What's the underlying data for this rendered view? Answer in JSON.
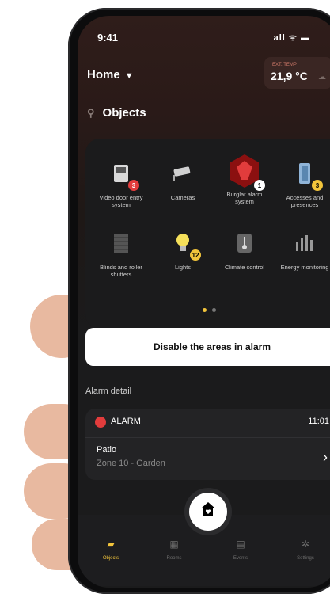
{
  "status": {
    "time": "9:41",
    "icons": "all ᯤ ▬"
  },
  "header": {
    "home_label": "Home",
    "temp_label": "EXT. TEMP",
    "temp_value": "21,9 °C"
  },
  "objects": {
    "title": "Objects",
    "tiles": [
      {
        "label": "Video door entry system",
        "icon": "door-entry-icon",
        "badge": "3"
      },
      {
        "label": "Cameras",
        "icon": "camera-icon",
        "badge": ""
      },
      {
        "label": "Burglar alarm system",
        "icon": "alarm-icon",
        "badge": "1"
      },
      {
        "label": "Accesses and presences",
        "icon": "access-icon",
        "badge": "3"
      },
      {
        "label": "Blinds and roller shutters",
        "icon": "blinds-icon",
        "badge": ""
      },
      {
        "label": "Lights",
        "icon": "bulb-icon",
        "badge": "12"
      },
      {
        "label": "Climate control",
        "icon": "thermometer-icon",
        "badge": ""
      },
      {
        "label": "Energy monitoring",
        "icon": "energy-icon",
        "badge": ""
      }
    ]
  },
  "actions": {
    "disable_alarm": "Disable the areas in alarm"
  },
  "alarm": {
    "section_title": "Alarm detail",
    "status": "ALARM",
    "time": "11:01",
    "place": "Patio",
    "zone": "Zone 10 - Garden"
  },
  "nav": {
    "items": [
      {
        "label": "Objects",
        "active": true
      },
      {
        "label": "Rooms",
        "active": false
      },
      {
        "label": "Events",
        "active": false
      },
      {
        "label": "Settings",
        "active": false
      }
    ]
  },
  "colors": {
    "accent": "#f2c43b",
    "alarm_red": "#e23c3c",
    "alarm_hex": "#8b1010"
  }
}
